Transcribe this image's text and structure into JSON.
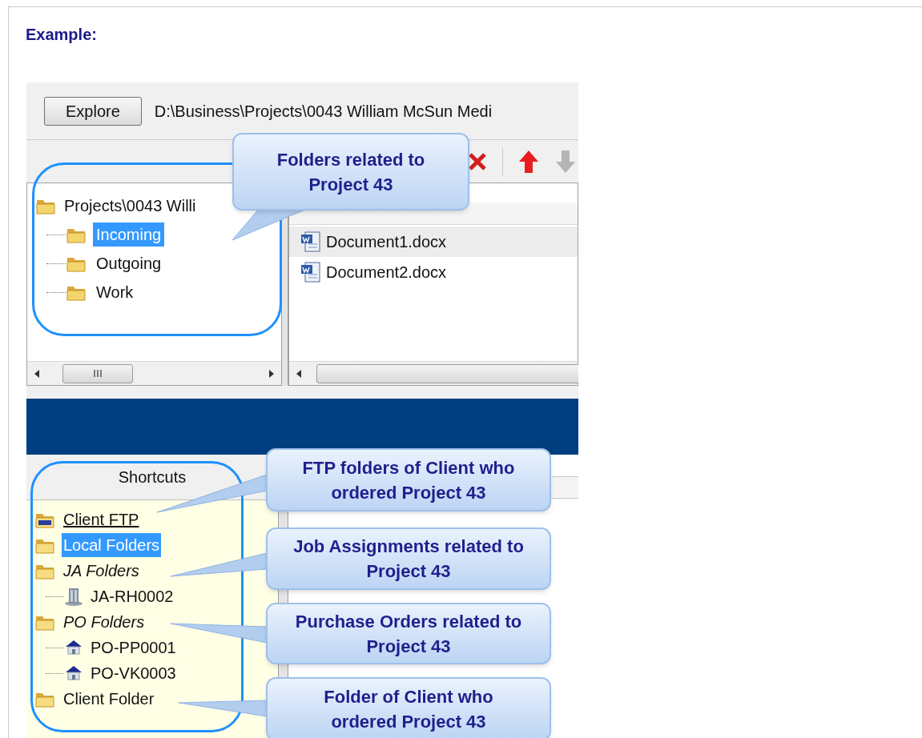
{
  "heading": "Example:",
  "explorer": {
    "button": "Explore",
    "path": "D:\\Business\\Projects\\0043 William McSun Medi",
    "tree": {
      "label": "Projects\\0043 Willi",
      "children": [
        {
          "label": "Incoming",
          "selected": true
        },
        {
          "label": "Outgoing",
          "selected": false
        },
        {
          "label": "Work",
          "selected": false
        }
      ]
    },
    "files": [
      {
        "name": "Document1.docx",
        "selected": true
      },
      {
        "name": "Document2.docx",
        "selected": false
      }
    ]
  },
  "shortcuts": {
    "title": "Shortcuts",
    "items": [
      {
        "label": "Client FTP",
        "kind": "ftp",
        "selected": false
      },
      {
        "label": "Local Folders",
        "kind": "folder",
        "selected": true
      },
      {
        "label": "JA Folders",
        "kind": "group",
        "selected": false,
        "children": [
          {
            "label": "JA-RH0002",
            "kind": "building"
          }
        ]
      },
      {
        "label": "PO Folders",
        "kind": "group",
        "selected": false,
        "children": [
          {
            "label": "PO-PP0001",
            "kind": "house"
          },
          {
            "label": "PO-VK0003",
            "kind": "house"
          }
        ]
      },
      {
        "label": "Client Folder",
        "kind": "folder",
        "selected": false
      }
    ]
  },
  "callouts": [
    "Folders related to Project 43",
    "FTP folders of Client who ordered Project 43",
    "Job Assignments related to Project 43",
    "Purchase Orders related to Project 43",
    "Folder of Client who ordered Project 43"
  ]
}
